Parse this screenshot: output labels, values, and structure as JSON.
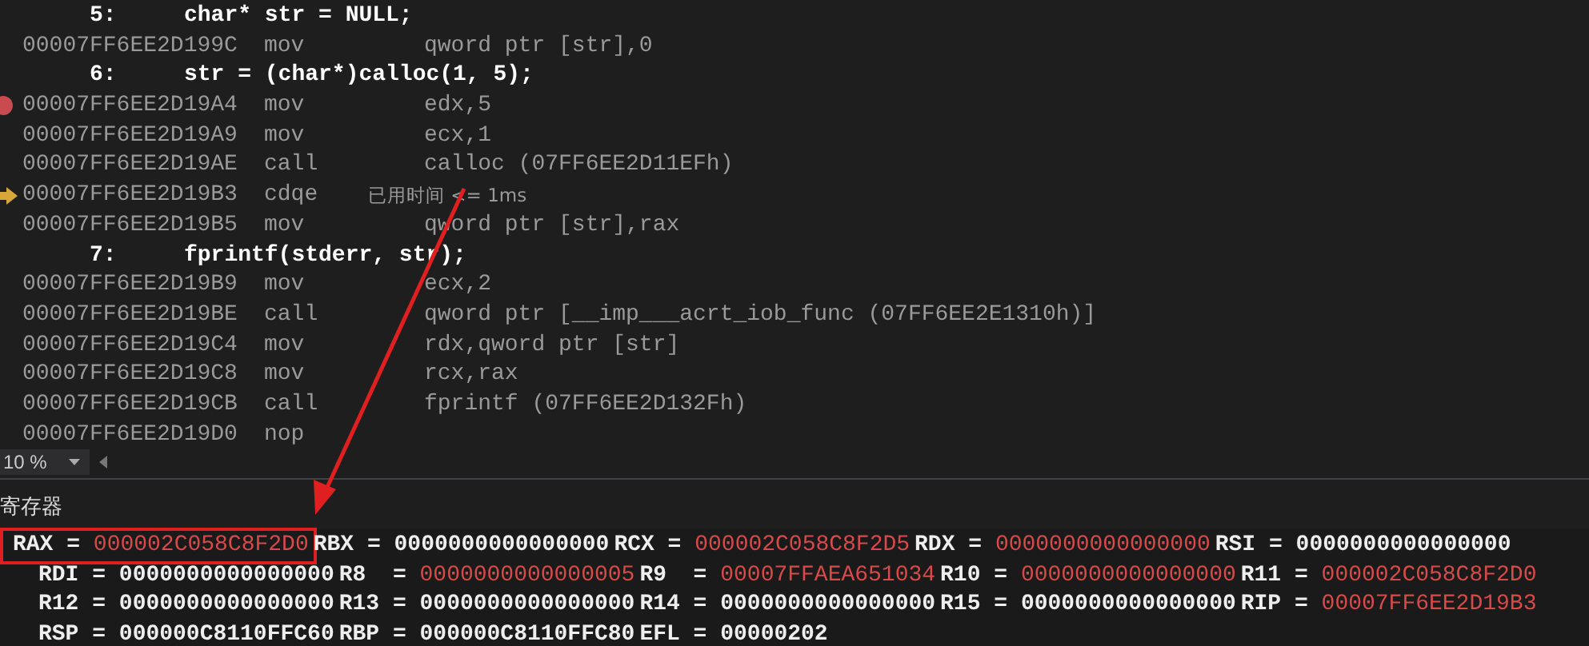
{
  "disassembly": {
    "lines": [
      {
        "kind": "source",
        "line_no": "5:",
        "code": "char* str = NULL;"
      },
      {
        "kind": "asm",
        "address": "00007FF6EE2D199C",
        "mnemonic": "mov",
        "operands": "qword ptr [str],0",
        "breakpoint": false,
        "current": false
      },
      {
        "kind": "source",
        "line_no": "6:",
        "code": "str = (char*)calloc(1, 5);"
      },
      {
        "kind": "asm",
        "address": "00007FF6EE2D19A4",
        "mnemonic": "mov",
        "operands": "edx,5",
        "breakpoint": true,
        "current": false
      },
      {
        "kind": "asm",
        "address": "00007FF6EE2D19A9",
        "mnemonic": "mov",
        "operands": "ecx,1",
        "breakpoint": false,
        "current": false
      },
      {
        "kind": "asm",
        "address": "00007FF6EE2D19AE",
        "mnemonic": "call",
        "operands": "calloc (07FF6EE2D11EFh)",
        "breakpoint": false,
        "current": false
      },
      {
        "kind": "asm",
        "address": "00007FF6EE2D19B3",
        "mnemonic": "cdqe",
        "elapsed": "已用时间 <= 1ms",
        "breakpoint": false,
        "current": true
      },
      {
        "kind": "asm",
        "address": "00007FF6EE2D19B5",
        "mnemonic": "mov",
        "operands": "qword ptr [str],rax",
        "breakpoint": false,
        "current": false
      },
      {
        "kind": "source",
        "line_no": "7:",
        "code": "fprintf(stderr, str);"
      },
      {
        "kind": "asm",
        "address": "00007FF6EE2D19B9",
        "mnemonic": "mov",
        "operands": "ecx,2",
        "breakpoint": false,
        "current": false
      },
      {
        "kind": "asm",
        "address": "00007FF6EE2D19BE",
        "mnemonic": "call",
        "operands": "qword ptr [__imp___acrt_iob_func (07FF6EE2E1310h)]",
        "breakpoint": false,
        "current": false
      },
      {
        "kind": "asm",
        "address": "00007FF6EE2D19C4",
        "mnemonic": "mov",
        "operands": "rdx,qword ptr [str]",
        "breakpoint": false,
        "current": false
      },
      {
        "kind": "asm",
        "address": "00007FF6EE2D19C8",
        "mnemonic": "mov",
        "operands": "rcx,rax",
        "breakpoint": false,
        "current": false
      },
      {
        "kind": "asm",
        "address": "00007FF6EE2D19CB",
        "mnemonic": "call",
        "operands": "fprintf (07FF6EE2D132Fh)",
        "breakpoint": false,
        "current": false
      },
      {
        "kind": "asm",
        "address": "00007FF6EE2D19D0",
        "mnemonic": "nop",
        "breakpoint": false,
        "current": false
      }
    ],
    "zoom": "10 %"
  },
  "registers": {
    "title": "寄存器",
    "rows": [
      [
        {
          "name": "RAX",
          "equals": "=",
          "value": "000002C058C8F2D0",
          "changed": true,
          "highlighted": true
        },
        {
          "name": "RBX",
          "equals": "=",
          "value": "0000000000000000",
          "changed": false,
          "highlighted": false
        },
        {
          "name": "RCX",
          "equals": "=",
          "value": "000002C058C8F2D5",
          "changed": true,
          "highlighted": false
        },
        {
          "name": "RDX",
          "equals": "=",
          "value": "0000000000000000",
          "changed": true,
          "highlighted": false
        },
        {
          "name": "RSI",
          "equals": "=",
          "value": "0000000000000000",
          "changed": false,
          "highlighted": false
        }
      ],
      [
        {
          "name": "RDI",
          "equals": "=",
          "value": "0000000000000000",
          "changed": false,
          "highlighted": false
        },
        {
          "name": "R8",
          "equals": "=",
          "value": "0000000000000005",
          "changed": true,
          "highlighted": false
        },
        {
          "name": "R9",
          "equals": "=",
          "value": "00007FFAEA651034",
          "changed": true,
          "highlighted": false
        },
        {
          "name": "R10",
          "equals": "=",
          "value": "0000000000000000",
          "changed": true,
          "highlighted": false
        },
        {
          "name": "R11",
          "equals": "=",
          "value": "000002C058C8F2D0",
          "changed": true,
          "highlighted": false
        }
      ],
      [
        {
          "name": "R12",
          "equals": "=",
          "value": "0000000000000000",
          "changed": false,
          "highlighted": false
        },
        {
          "name": "R13",
          "equals": "=",
          "value": "0000000000000000",
          "changed": false,
          "highlighted": false
        },
        {
          "name": "R14",
          "equals": "=",
          "value": "0000000000000000",
          "changed": false,
          "highlighted": false
        },
        {
          "name": "R15",
          "equals": "=",
          "value": "0000000000000000",
          "changed": false,
          "highlighted": false
        },
        {
          "name": "RIP",
          "equals": "=",
          "value": "00007FF6EE2D19B3",
          "changed": true,
          "highlighted": false
        }
      ],
      [
        {
          "name": "RSP",
          "equals": "=",
          "value": "000000C8110FFC60",
          "changed": false,
          "highlighted": false
        },
        {
          "name": "RBP",
          "equals": "=",
          "value": "000000C8110FFC80",
          "changed": false,
          "highlighted": false
        },
        {
          "name": "EFL",
          "equals": "=",
          "value": "00000202",
          "changed": false,
          "highlighted": false
        }
      ]
    ]
  }
}
